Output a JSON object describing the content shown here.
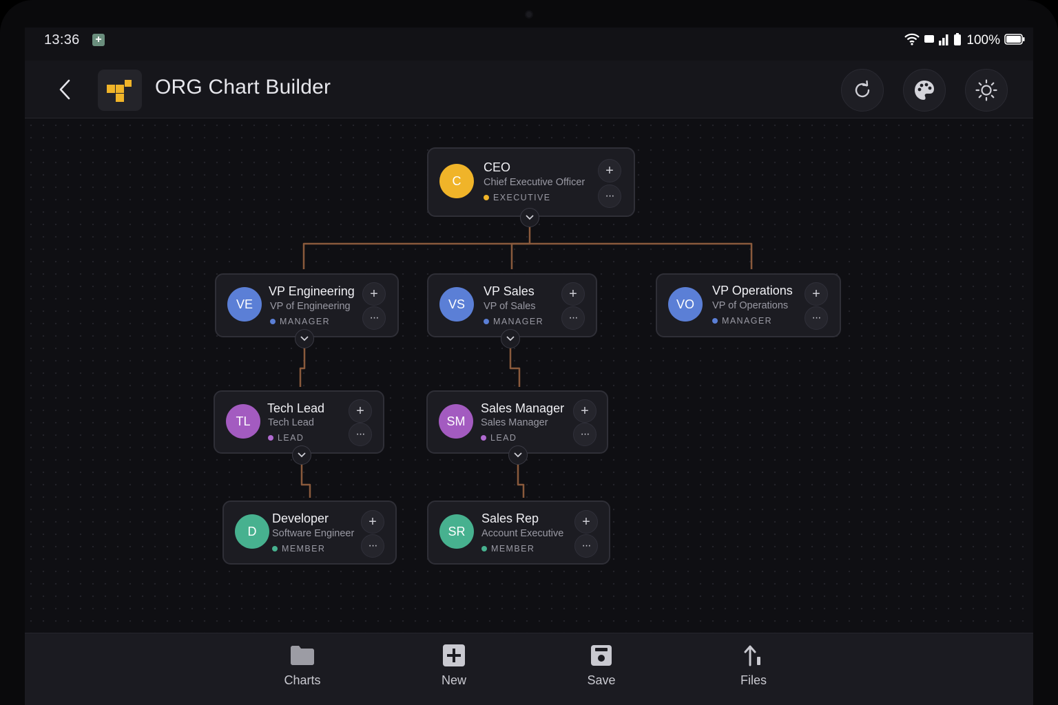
{
  "status_bar": {
    "time": "13:36",
    "battery": "100%"
  },
  "header": {
    "title": "ORG Chart Builder"
  },
  "colors": {
    "accent": "#f0b429",
    "connector": "#8a5a3c",
    "background": "#0f0f13"
  },
  "nodes": {
    "ceo": {
      "initials": "C",
      "title": "CEO",
      "subtitle": "Chief Executive Officer",
      "role": "EXECUTIVE",
      "color": "#f0b429",
      "dot": "#f0b429"
    },
    "vp_eng": {
      "initials": "VE",
      "title": "VP Engineering",
      "subtitle": "VP of Engineering",
      "role": "MANAGER",
      "color": "#5b7fd6",
      "dot": "#5b7fd6"
    },
    "vp_sales": {
      "initials": "VS",
      "title": "VP Sales",
      "subtitle": "VP of Sales",
      "role": "MANAGER",
      "color": "#5b7fd6",
      "dot": "#5b7fd6"
    },
    "vp_ops": {
      "initials": "VO",
      "title": "VP Operations",
      "subtitle": "VP of Operations",
      "role": "MANAGER",
      "color": "#5b7fd6",
      "dot": "#5b7fd6"
    },
    "tech_lead": {
      "initials": "TL",
      "title": "Tech Lead",
      "subtitle": "Tech Lead",
      "role": "LEAD",
      "color": "#a35bc0",
      "dot": "#b06ad0"
    },
    "sales_mgr": {
      "initials": "SM",
      "title": "Sales Manager",
      "subtitle": "Sales Manager",
      "role": "LEAD",
      "color": "#a35bc0",
      "dot": "#b06ad0"
    },
    "developer": {
      "initials": "D",
      "title": "Developer",
      "subtitle": "Software Engineer",
      "role": "MEMBER",
      "color": "#47b18f",
      "dot": "#47b18f"
    },
    "sales_rep": {
      "initials": "SR",
      "title": "Sales Rep",
      "subtitle": "Account Executive",
      "role": "MEMBER",
      "color": "#47b18f",
      "dot": "#47b18f"
    }
  },
  "bottom_nav": [
    {
      "label": "Charts",
      "icon": "folder-icon"
    },
    {
      "label": "New",
      "icon": "plus-square-icon"
    },
    {
      "label": "Save",
      "icon": "save-icon"
    },
    {
      "label": "Files",
      "icon": "upload-icon"
    }
  ]
}
